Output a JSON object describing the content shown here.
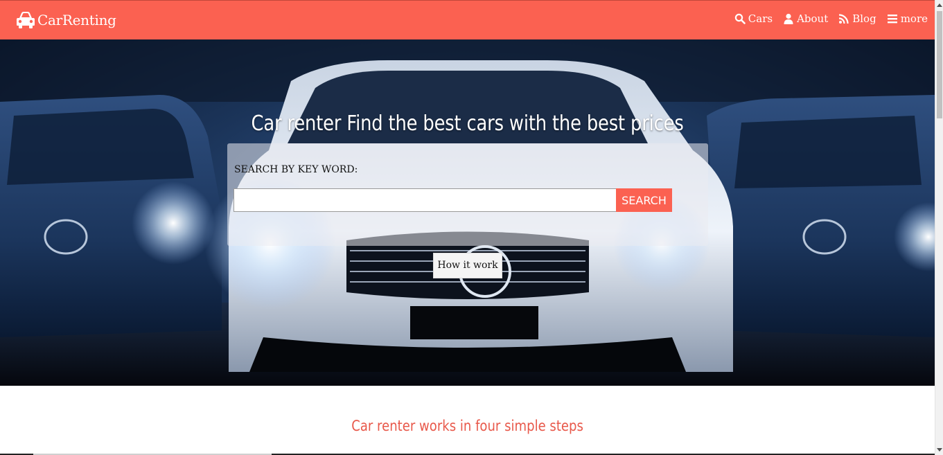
{
  "colors": {
    "primary": "#fb6151",
    "steps_title": "#e8584a",
    "white": "#ffffff"
  },
  "navbar": {
    "brand_icon": "car-icon",
    "brand_name": "CarRenting",
    "links": [
      {
        "icon": "search-icon",
        "label": "Cars"
      },
      {
        "icon": "user-icon",
        "label": "About"
      },
      {
        "icon": "rss-icon",
        "label": "Blog"
      },
      {
        "icon": "menu-icon",
        "label": "more"
      }
    ]
  },
  "hero": {
    "title": "Car renter Find the best cars with the best prices",
    "search_label": "SEARCH BY KEY WORD:",
    "search_value": "",
    "search_button": "SEARCH",
    "how_button": "How it work"
  },
  "steps": {
    "title": "Car renter works in four simple steps"
  }
}
